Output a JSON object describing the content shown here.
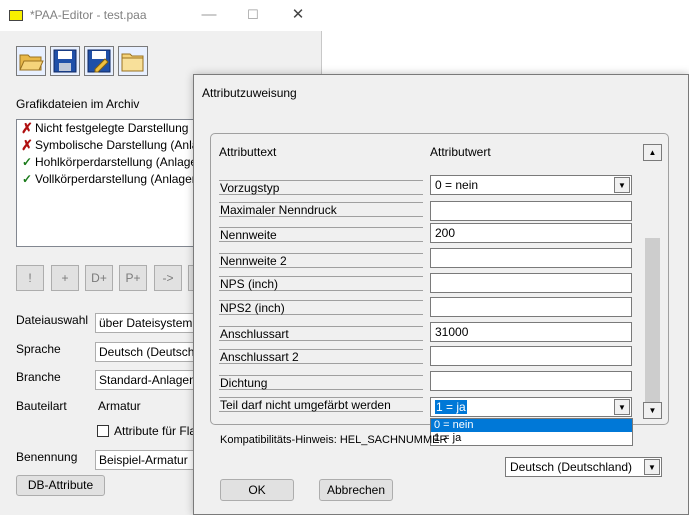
{
  "main_window": {
    "title": "*PAA-Editor - test.paa",
    "controls": {
      "minimize": "—",
      "maximize": "☐",
      "close": "✕"
    },
    "section_label": "Grafikdateien im Archiv",
    "files": [
      {
        "status": "invalid",
        "label": "Nicht festgelegte Darstellung"
      },
      {
        "status": "invalid",
        "label": "Symbolische Darstellung (Anlagen"
      },
      {
        "status": "ok",
        "label": "Hohlkörperdarstellung (Anlagenb"
      },
      {
        "status": "ok",
        "label": "Vollkörperdarstellung (Anlagenba"
      }
    ],
    "small_buttons": [
      "!",
      "+",
      "D+",
      "P+",
      "->"
    ],
    "form": {
      "dateiauswahl_label": "Dateiauswahl",
      "dateiauswahl_value": "über Dateisystem",
      "sprache_label": "Sprache",
      "sprache_value": "Deutsch (Deutschla",
      "branche_label": "Branche",
      "branche_value": "Standard-Anlagenb",
      "bauteilart_label": "Bauteilart",
      "bauteilart_value": "Armatur",
      "checkbox_label": "Attribute für Flar",
      "benennung_label": "Benennung",
      "benennung_value": "Beispiel-Armatur",
      "db_button": "DB-Attribute"
    }
  },
  "dialog": {
    "title": "Attributzuweisung",
    "col_text": "Attributtext",
    "col_value": "Attributwert",
    "rows": [
      {
        "label": "Vorzugstyp",
        "value": "0 = nein",
        "combo": true
      },
      {
        "label": "Maximaler Nenndruck",
        "value": ""
      },
      {
        "label": "Nennweite",
        "value": "200"
      },
      {
        "label": "Nennweite 2",
        "value": ""
      },
      {
        "label": "NPS (inch)",
        "value": ""
      },
      {
        "label": "NPS2 (inch)",
        "value": ""
      },
      {
        "label": "Anschlussart",
        "value": "31000"
      },
      {
        "label": "Anschlussart 2",
        "value": ""
      },
      {
        "label": "Dichtung",
        "value": ""
      },
      {
        "label": "Teil darf nicht umgefärbt werden",
        "value": "1 = ja",
        "combo": true
      }
    ],
    "dropdown_options": [
      "0 = nein",
      "1 = ja"
    ],
    "hint": "Kompatibilitäts-Hinweis: HEL_SACHNUMMER",
    "language_value": "Deutsch (Deutschland)",
    "ok_button": "OK",
    "cancel_button": "Abbrechen",
    "accent_color": "#0078d7"
  }
}
